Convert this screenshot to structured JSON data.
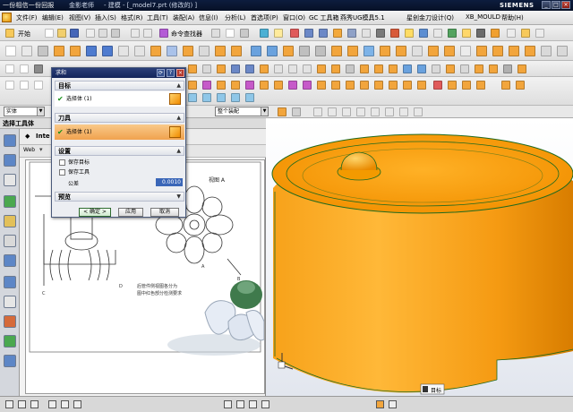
{
  "window": {
    "brand": "一份相信一份回报",
    "author": "金影老师",
    "document_title": "- 建模 - [_model7.prt  (修改的) ]",
    "vendor": "SIEMENS",
    "buttons": [
      "_",
      "□",
      "×"
    ]
  },
  "menu": {
    "items": [
      "文件(F)",
      "编辑(E)",
      "视图(V)",
      "插入(S)",
      "格式(R)",
      "工具(T)",
      "装配(A)",
      "信息(I)",
      "分析(L)",
      "首选项(P)",
      "窗口(O)",
      "GC 工具箱",
      "燕秀UG模具5.1",
      "星创金刀设计(Q)",
      "XB_MOULD",
      "帮助(H)"
    ],
    "start_label": "开始",
    "command_finder_label": "命令查找器"
  },
  "selection_bar": {
    "filter_value": "实体",
    "scope_value": "整个装配"
  },
  "panel": {
    "title": "选择工具体",
    "tab_label": "Inte",
    "web_label": "Web"
  },
  "drawing": {
    "view_label": "视图 A",
    "note_line1": "后管件侧视图各分为",
    "note_line2": "图中红色部分检测要求",
    "dim_labels": [
      "A",
      "B",
      "C",
      "D"
    ]
  },
  "dialog": {
    "title": "求和",
    "target_group": "目标",
    "target_select": "选择体 (1)",
    "tool_group": "刀具",
    "tool_select": "选择体 (1)",
    "settings_group": "设置",
    "keep_target": "保存目标",
    "keep_tool": "保存工具",
    "tolerance_label": "公差",
    "tolerance_value": "0.0010",
    "preview_group": "预览",
    "ok_label": "< 确定 >",
    "apply_label": "应用",
    "cancel_label": "取消"
  },
  "viewport": {
    "tooltip": "目标",
    "colors": {
      "body": "#f7a21a",
      "edge": "#1f6a1f",
      "highlight": "#ffd56a"
    }
  },
  "colors": {
    "titlebar": "#0d1d3e",
    "dialog_title": "#1e3270",
    "accent_orange": "#f08a00"
  }
}
